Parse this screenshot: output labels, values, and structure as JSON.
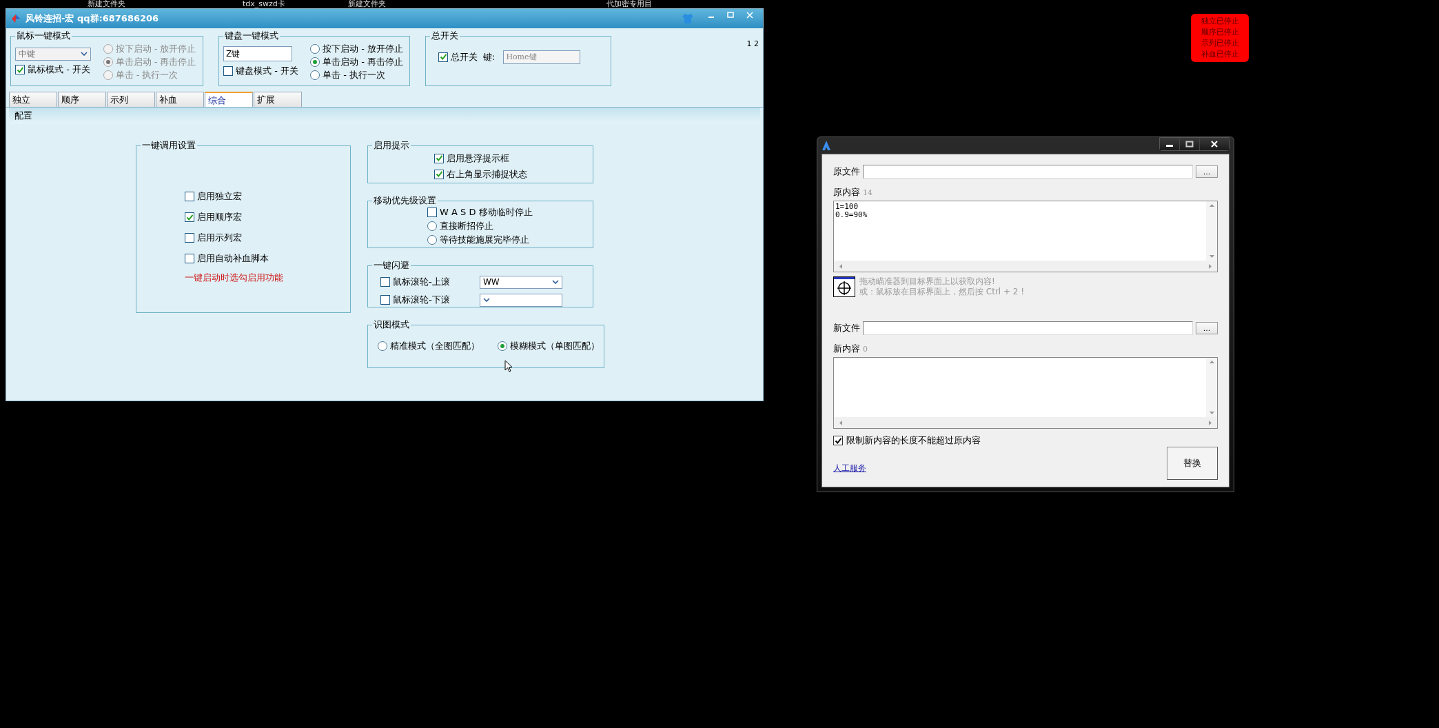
{
  "desktop_labels": [
    "新建文件夹",
    "tdx_swzd卡",
    "新建文件夹",
    "代加密专用目"
  ],
  "main_window": {
    "title": "风铃连招-宏 qq群:687686206",
    "mouse_mode": {
      "title": "鼠标一键模式",
      "button_select": {
        "value": "中键",
        "disabled": true
      },
      "toggle": {
        "label": "鼠标模式 - 开关",
        "checked": true
      },
      "radios": [
        {
          "label": "按下启动 - 放开停止",
          "selected": false,
          "disabled": true
        },
        {
          "label": "单击启动 - 再击停止",
          "selected": true,
          "disabled": true
        },
        {
          "label": "单击 - 执行一次",
          "selected": false,
          "disabled": true
        }
      ]
    },
    "keyboard_mode": {
      "title": "键盘一键模式",
      "key_field": {
        "value": "Z键",
        "disabled": false
      },
      "toggle": {
        "label": "键盘模式 - 开关",
        "checked": false
      },
      "radios": [
        {
          "label": "按下启动 - 放开停止",
          "selected": false,
          "disabled": false
        },
        {
          "label": "单击启动 - 再击停止",
          "selected": true,
          "disabled": false
        },
        {
          "label": "单击 - 执行一次",
          "selected": false,
          "disabled": false
        }
      ]
    },
    "master_switch": {
      "title": "总开关",
      "toggle": {
        "label": "总开关",
        "checked": true
      },
      "key_label": "键:",
      "key_field": {
        "placeholder": "Home键"
      }
    },
    "page_indicator": "1 2",
    "tabs": [
      {
        "label": "独立",
        "selected": false
      },
      {
        "label": "顺序",
        "selected": false
      },
      {
        "label": "示列",
        "selected": false
      },
      {
        "label": "补血",
        "selected": false
      },
      {
        "label": "综合",
        "selected": true
      },
      {
        "label": "扩展",
        "selected": false
      }
    ],
    "section_header": "配置",
    "one_key_settings": {
      "title": "一键调用设置",
      "options": [
        {
          "label": "启用独立宏",
          "checked": false
        },
        {
          "label": "启用顺序宏",
          "checked": true
        },
        {
          "label": "启用示列宏",
          "checked": false
        },
        {
          "label": "启用自动补血脚本",
          "checked": false
        }
      ],
      "note": "一键启动时选勾启用功能"
    },
    "hint_settings": {
      "title": "启用提示",
      "options": [
        {
          "label": "启用悬浮提示框",
          "checked": true
        },
        {
          "label": "右上角显示捕捉状态",
          "checked": true
        }
      ]
    },
    "move_priority": {
      "title": "移动优先级设置",
      "items": [
        {
          "kind": "checkbox",
          "label": "W A S D 移动临时停止",
          "checked": false
        },
        {
          "kind": "radio",
          "label": "直接断招停止",
          "selected": false
        },
        {
          "kind": "radio",
          "label": "等待技能施展完毕停止",
          "selected": false
        }
      ]
    },
    "dodge": {
      "title": "一键闪避",
      "rows": [
        {
          "label": "鼠标滚轮-上滚",
          "checked": false,
          "value": "WW"
        },
        {
          "label": "鼠标滚轮-下滚",
          "checked": false
        }
      ]
    },
    "recognition_mode": {
      "title": "识图模式",
      "radios": [
        {
          "label": "精准模式（全图匹配）",
          "selected": false
        },
        {
          "label": "模糊模式（单图匹配）",
          "selected": true
        }
      ]
    }
  },
  "replace_window": {
    "source": {
      "file_label": "原文件",
      "browse": "...",
      "content_label": "原内容",
      "count": "14",
      "content_lines": [
        "1=100",
        "0.9=90%"
      ]
    },
    "hint_lines": [
      "拖动瞄准器到目标界面上以获取内容!",
      "或：鼠标放在目标界面上，然后按 Ctrl + 2 !"
    ],
    "target": {
      "file_label": "新文件",
      "browse": "...",
      "content_label": "新内容",
      "count": "0"
    },
    "limit_option": {
      "label": "限制新内容的长度不能超过原内容",
      "checked": true
    },
    "service_link": "人工服务",
    "replace_button": "替换"
  },
  "status_overlay": {
    "lines": [
      "独立已停止",
      "顺序已停止",
      "示列已停止",
      "补血已停止"
    ]
  }
}
